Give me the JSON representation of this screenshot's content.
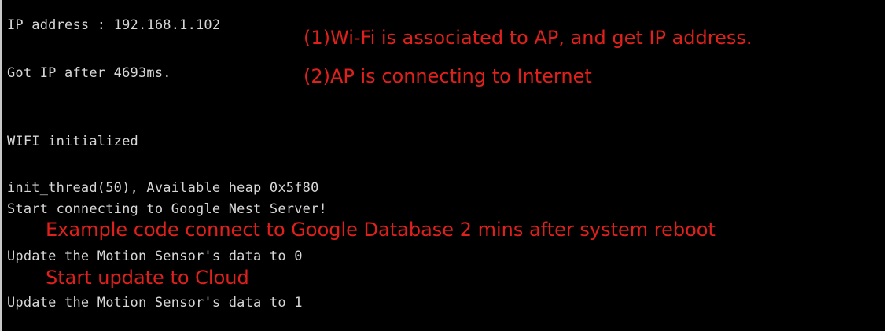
{
  "console": {
    "lines": [
      "IP address : 192.168.1.102",
      "Got IP after 4693ms.",
      "WIFI initialized",
      "init_thread(50), Available heap 0x5f80",
      "Start connecting to Google Nest Server!",
      "Update the Motion Sensor's data to 0",
      "Update the Motion Sensor's data to 1"
    ]
  },
  "annotations": {
    "wifi_associated": "(1)Wi-Fi is associated to AP, and get IP address.",
    "ap_connecting": "(2)AP is connecting to Internet",
    "example_code": "Example code connect to Google Database 2 mins after system reboot",
    "start_update": "Start update to Cloud"
  },
  "colors": {
    "background": "#000000",
    "console_text": "#d7d7d7",
    "annotation_text": "#e0201c"
  }
}
